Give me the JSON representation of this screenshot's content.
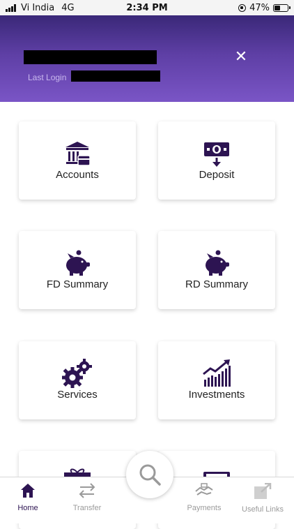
{
  "status_bar": {
    "carrier": "Vi India",
    "network": "4G",
    "time": "2:34 PM",
    "battery_percent": "47%",
    "battery_level": 0.47
  },
  "header": {
    "last_login_label": "Last Login",
    "close_icon": "close-icon"
  },
  "tiles": [
    {
      "label": "Accounts",
      "icon": "bank-icon"
    },
    {
      "label": "Deposit",
      "icon": "deposit-icon"
    },
    {
      "label": "FD Summary",
      "icon": "piggy-bank-icon"
    },
    {
      "label": "RD Summary",
      "icon": "piggy-bank-icon"
    },
    {
      "label": "Services",
      "icon": "gears-icon"
    },
    {
      "label": "Investments",
      "icon": "growth-chart-icon"
    }
  ],
  "bottom_nav": {
    "items": [
      {
        "label": "Home",
        "icon": "home-icon",
        "active": true
      },
      {
        "label": "Transfer",
        "icon": "transfer-icon",
        "active": false
      },
      {
        "label": "Payments",
        "icon": "payments-icon",
        "active": false
      },
      {
        "label": "Useful Links",
        "icon": "external-link-icon",
        "active": false
      }
    ],
    "search_icon": "search-icon"
  },
  "colors": {
    "brand_purple": "#2d1452",
    "header_top": "#3a2878",
    "header_bottom": "#7a55c6",
    "inactive_nav": "#9a9a9a"
  }
}
